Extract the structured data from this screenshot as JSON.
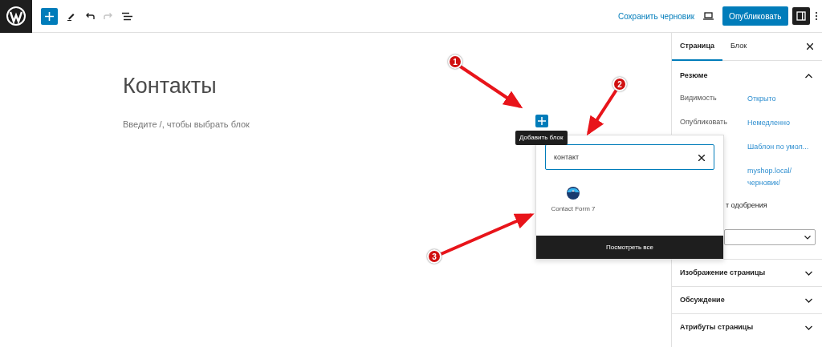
{
  "toolbar": {
    "redo_disabled": true,
    "save_draft": "Сохранить черновик",
    "publish": "Опубликовать",
    "settings_pressed": true
  },
  "editor": {
    "title": "Контакты",
    "placeholder": "Введите /, чтобы выбрать блок"
  },
  "inserter": {
    "tooltip": "Добавить блок",
    "search": {
      "value": "контакт"
    },
    "results": [
      {
        "label": "Contact Form 7"
      }
    ],
    "footer_button": "Посмотреть все"
  },
  "sidebar": {
    "tabs": [
      {
        "label": "Страница",
        "selected": true
      },
      {
        "label": "Блок",
        "selected": false
      }
    ],
    "summary": {
      "title": "Резюме",
      "expanded": true,
      "rows": [
        {
          "label": "Видимость",
          "value": "Открыто"
        },
        {
          "label": "Опубликовать",
          "value": "Немедленно"
        },
        {
          "value": "Шаблон по умол..."
        },
        {
          "value": "myshop.local/ черновик/"
        }
      ],
      "pending_text": "т одобрения"
    },
    "panels": [
      {
        "title": "Изображение страницы",
        "expanded": false
      },
      {
        "title": "Обсуждение",
        "expanded": false
      },
      {
        "title": "Атрибуты страницы",
        "expanded": false
      }
    ]
  },
  "annotations": [
    {
      "number": "1"
    },
    {
      "number": "2"
    },
    {
      "number": "3"
    }
  ]
}
